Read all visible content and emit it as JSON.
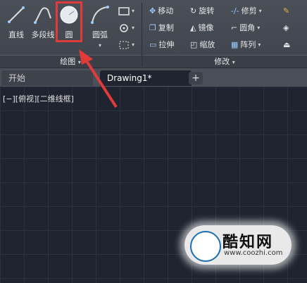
{
  "ribbon": {
    "draw_panel": {
      "label": "绘图",
      "line": "直线",
      "polyline": "多段线",
      "circle": "圆",
      "arc": "圆弧"
    },
    "modify_panel": {
      "label": "修改",
      "move": "移动",
      "rotate": "旋转",
      "trim": "修剪",
      "copy": "复制",
      "mirror": "镜像",
      "fillet": "圆角",
      "stretch": "拉伸",
      "scale": "缩放",
      "array": "阵列"
    }
  },
  "tabs": {
    "start": "开始",
    "drawing": "Drawing1*",
    "plus": "+"
  },
  "viewport": {
    "label": "[−][俯视][二维线框]"
  },
  "watermark": {
    "text": "酷知网",
    "url": "www.coozhi.com"
  },
  "colors": {
    "highlight": "#e03a3a",
    "canvas": "#1f2430"
  }
}
